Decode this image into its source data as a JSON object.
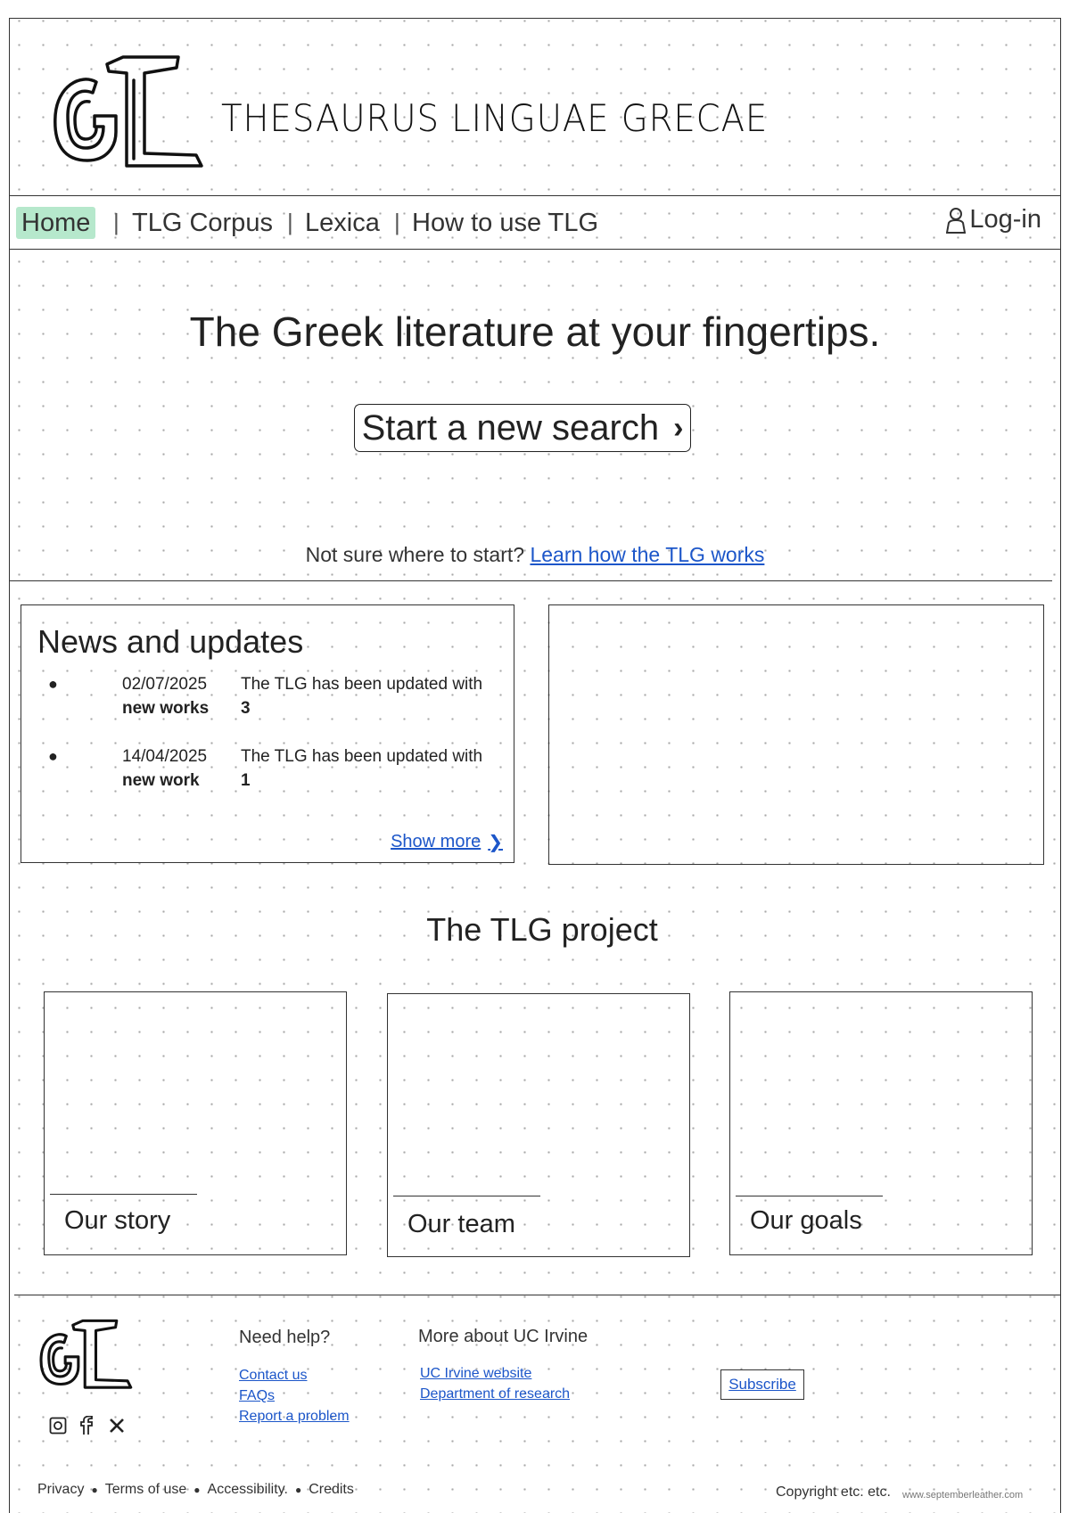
{
  "header": {
    "title": "THESAURUS LINGUAE GRECAE"
  },
  "nav": {
    "items": [
      {
        "label": "Home",
        "active": true
      },
      {
        "label": "TLG Corpus",
        "active": false
      },
      {
        "label": "Lexica",
        "active": false
      },
      {
        "label": "How to use TLG",
        "active": false
      }
    ],
    "separator": "|",
    "login_label": "Log-in"
  },
  "hero": {
    "headline": "The Greek literature at your fingertips.",
    "search_button_label": "Start a new search",
    "hint_text": "Not sure where to start?",
    "hint_link": "Learn how the TLG works"
  },
  "news": {
    "title": "News and updates",
    "items": [
      {
        "date": "02/07/2025",
        "text": "The TLG has been updated with",
        "count": "3",
        "unit": "new works"
      },
      {
        "date": "14/04/2025",
        "text": "The TLG has been updated with",
        "count": "1",
        "unit": "new work"
      }
    ],
    "show_more": "Show more"
  },
  "project": {
    "title": "The TLG project",
    "cards": [
      {
        "label": "Our story"
      },
      {
        "label": "Our team"
      },
      {
        "label": "Our goals"
      }
    ]
  },
  "footer": {
    "help_heading": "Need help?",
    "help_links": [
      "Contact us",
      "FAQs",
      "Report a problem"
    ],
    "uc_heading": "More about UC Irvine",
    "uc_links": [
      "UC Irvine website",
      "Department of research"
    ],
    "subscribe_label": "Subscribe",
    "social_icons": [
      "instagram-icon",
      "facebook-icon",
      "x-icon"
    ],
    "legal_links": [
      "Privacy",
      "Terms of use",
      "Accessibility.",
      "Credits"
    ],
    "copyright": "Copyright etc. etc.",
    "watermark": "www.septemberleather.com"
  },
  "colors": {
    "accent_link": "#1c56c9",
    "nav_active_bg": "#b6e8cc",
    "ink": "#222222"
  }
}
